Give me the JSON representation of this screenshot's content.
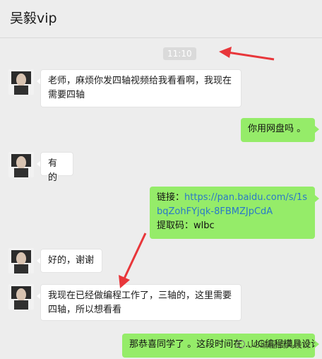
{
  "header": {
    "title": "吴毅vip"
  },
  "time_divider": "11:10",
  "messages": [
    {
      "from": "left",
      "text": "老师，麻烦你发四轴视频给我看看啊，我现在需要四轴"
    },
    {
      "from": "right",
      "text": "你用网盘吗 。"
    },
    {
      "from": "left",
      "text": "有的"
    },
    {
      "from": "right",
      "label_link": "链接：",
      "link": "https://pan.baidu.com/s/1sbqZohFYjqk-8FBMZJpCdA",
      "label_code": "提取码：",
      "code": "wlbc"
    },
    {
      "from": "left",
      "text": "好的，谢谢"
    },
    {
      "from": "left",
      "text": "我现在已经做编程工作了，三轴的，这里需要四轴，所以想看看"
    },
    {
      "from": "right",
      "text": "那恭喜同学了 。这段时间在...UG编程模具设计"
    }
  ],
  "watermark": "UG编程模具设计",
  "colors": {
    "accent_arrow": "#e8363a",
    "bubble_right": "#95ec69",
    "link": "#2a78c8"
  },
  "icons": {
    "avatar": "avatar-photo",
    "watermark": "wechat-logo-icon"
  }
}
